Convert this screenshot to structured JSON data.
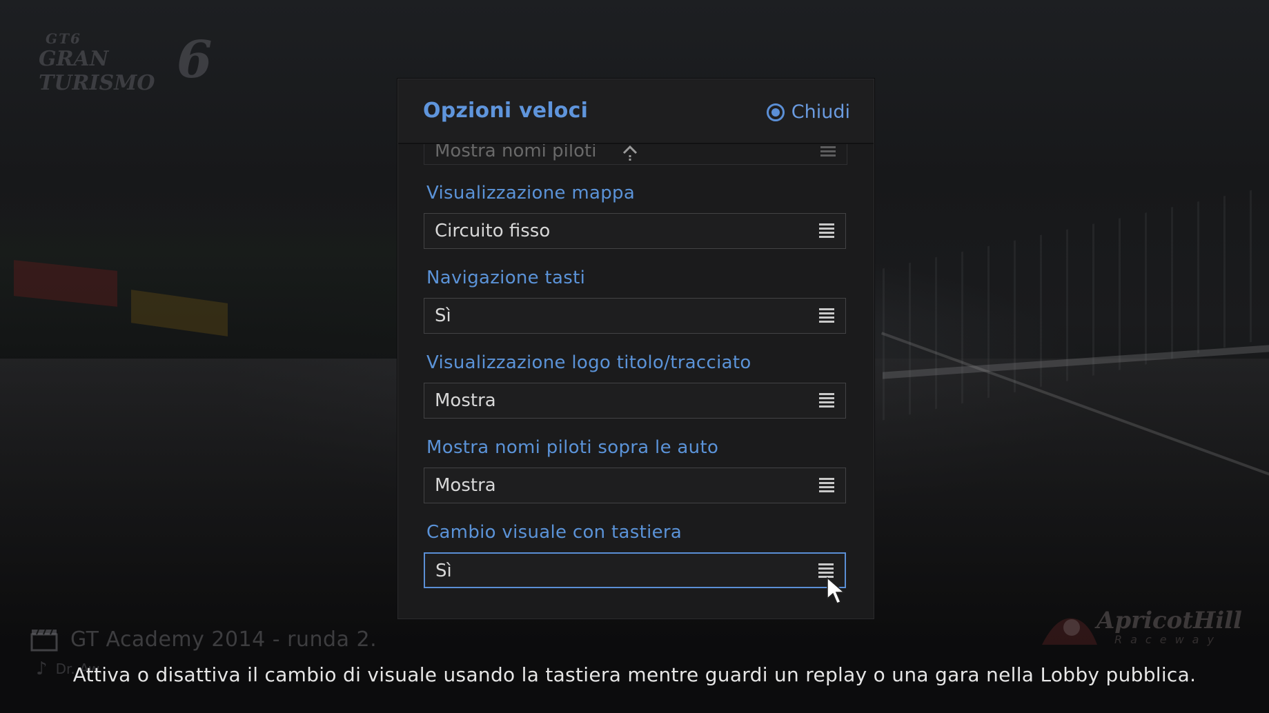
{
  "background": {
    "game_logo": {
      "line1": "GT6",
      "line2": "GRAN TURISMO",
      "number": "6"
    },
    "replay": {
      "title": "GT Academy 2014 - runda 2.",
      "music": "Dr. Aw..."
    },
    "track_logo": {
      "name": "ApricotHill",
      "subtitle": "Raceway"
    }
  },
  "panel": {
    "title": "Opzioni veloci",
    "close_label": "Chiudi",
    "partial_item": {
      "value": "Mostra nomi piloti"
    },
    "options": [
      {
        "label": "Visualizzazione mappa",
        "value": "Circuito fisso"
      },
      {
        "label": "Navigazione tasti",
        "value": "Sì"
      },
      {
        "label": "Visualizzazione logo titolo/tracciato",
        "value": "Mostra"
      },
      {
        "label": "Mostra nomi piloti sopra le auto",
        "value": "Mostra"
      },
      {
        "label": "Cambio visuale con tastiera",
        "value": "Sì"
      }
    ]
  },
  "description": "Attiva o disattiva il cambio di visuale usando la tastiera mentre guardi un replay o una gara nella Lobby pubblica.",
  "colors": {
    "accent": "#5b8fd6",
    "panel_bg": "#1b1b1c",
    "text": "#d8d8d8"
  },
  "icons": {
    "close": "circle-icon",
    "select": "menu-icon",
    "scroll": "arrow-up-icon",
    "cursor": "cursor-icon"
  }
}
